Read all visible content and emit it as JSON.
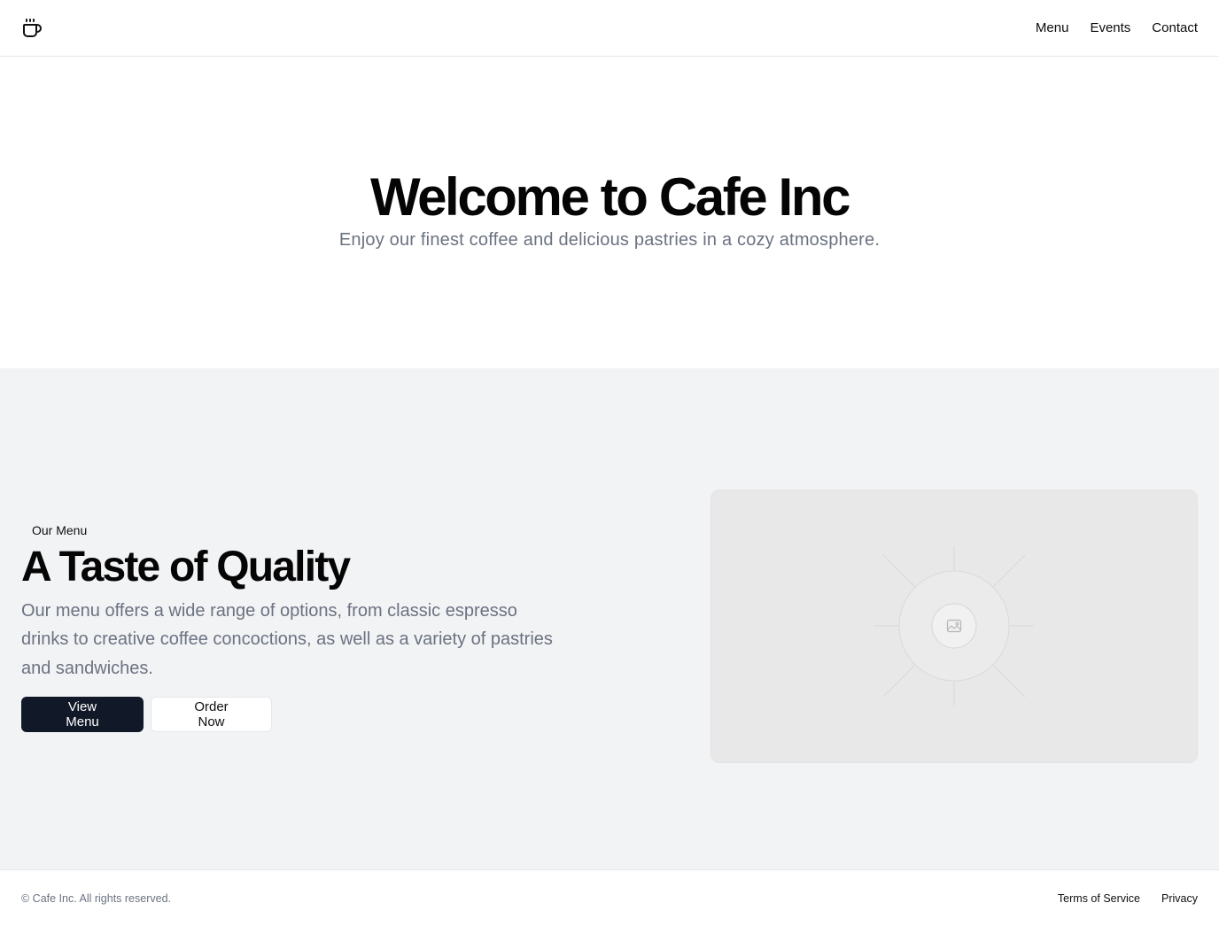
{
  "header": {
    "logo_icon": "coffee-cup-icon",
    "nav": [
      {
        "label": "Menu"
      },
      {
        "label": "Events"
      },
      {
        "label": "Contact"
      }
    ]
  },
  "hero": {
    "title": "Welcome to Cafe Inc",
    "subtitle": "Enjoy our finest coffee and delicious pastries in a cozy atmosphere."
  },
  "menu_section": {
    "eyebrow": "Our Menu",
    "title": "A Taste of Quality",
    "description": "Our menu offers a wide range of options, from classic espresso drinks to creative coffee concoctions, as well as a variety of pastries and sandwiches.",
    "primary_button": "View Menu",
    "secondary_button": "Order Now",
    "image_icon": "image-placeholder-icon"
  },
  "footer": {
    "copyright": "© Cafe Inc. All rights reserved.",
    "links": [
      {
        "label": "Terms of Service"
      },
      {
        "label": "Privacy"
      }
    ]
  },
  "colors": {
    "primary_button": "#111827",
    "section_background": "#f2f3f5",
    "muted_text": "#6b7280"
  }
}
